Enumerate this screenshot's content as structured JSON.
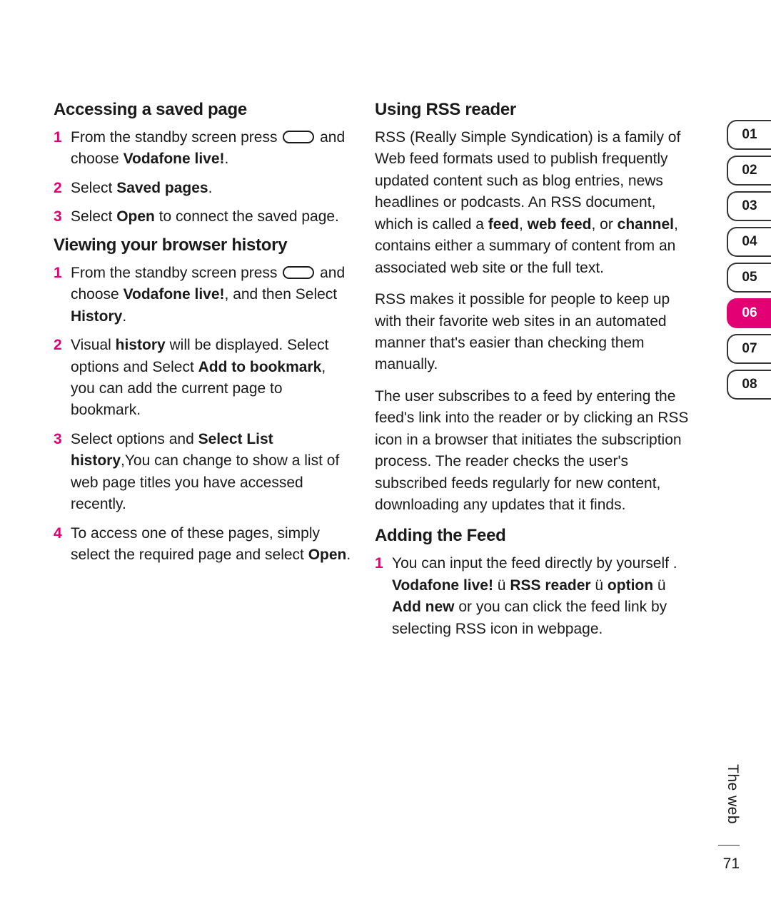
{
  "left": {
    "h1": "Accessing a saved page",
    "s1": [
      {
        "n": "1",
        "pre": "From the standby screen press ",
        "post": " and choose ",
        "b1": "Vodafone live!",
        "tail": "."
      },
      {
        "n": "2",
        "pre": "Select ",
        "b1": "Saved pages",
        "tail": "."
      },
      {
        "n": "3",
        "pre": "Select ",
        "b1": "Open",
        "tail": " to connect the saved page."
      }
    ],
    "h2": "Viewing your browser history",
    "s2": [
      {
        "n": "1",
        "pre": "From the standby screen press ",
        "post": " and choose ",
        "b1": "Vodafone live!",
        "mid": ", and then Select ",
        "b2": "History",
        "tail": "."
      },
      {
        "n": "2",
        "pre": "Visual ",
        "b1": "history",
        "mid": " will be displayed. Select options and Select ",
        "b2": "Add to bookmark",
        "tail": ", you can add the current page to bookmark."
      },
      {
        "n": "3",
        "pre": "Select options and ",
        "b1": "Select List history",
        "tail": ",You can change to show a list of web page titles you have accessed recently."
      },
      {
        "n": "4",
        "pre": "To access one of these pages, simply select the required page and select ",
        "b1": "Open",
        "tail": "."
      }
    ]
  },
  "right": {
    "h1": "Using RSS reader",
    "p1a": "RSS (Really Simple Syndication) is a family of Web feed formats used to publish frequently updated content such as blog entries, news headlines or podcasts. An RSS document, which is called a ",
    "p1b1": "feed",
    "p1c": ", ",
    "p1b2": "web feed",
    "p1d": ", or ",
    "p1b3": "channel",
    "p1e": ", contains either a summary of content from an associated web site or the full text.",
    "p2": "RSS makes it possible for people to keep up with their favorite web sites in an automated manner that's easier than checking them manually.",
    "p3": "The user subscribes to a feed by entering the feed's link into the reader or by clicking an RSS icon in a browser that initiates the subscription process. The reader checks the user's subscribed feeds regularly for new content, downloading any updates that it finds.",
    "h2": "Adding the Feed",
    "f1": {
      "n": "1",
      "pre": "You can input the feed directly by yourself . ",
      "b1": "Vodafone live!",
      "a1": " ü  ",
      "b2": "RSS reader",
      "a2": " ü  ",
      "b3": "option",
      "a3": " ü  ",
      "b4": "Add new",
      "tail": " or you can click the feed link by selecting RSS icon in webpage."
    }
  },
  "tabs": [
    "01",
    "02",
    "03",
    "04",
    "05",
    "06",
    "07",
    "08"
  ],
  "active_tab": "06",
  "section_label": "The web",
  "page_number": "71"
}
